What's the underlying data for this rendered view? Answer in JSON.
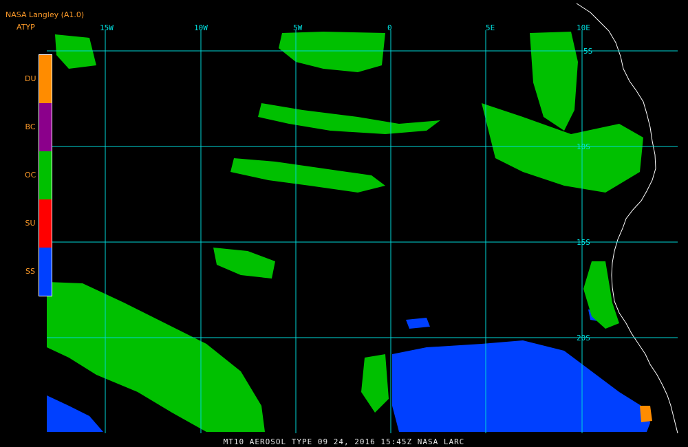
{
  "header": {
    "source": "NASA Langley (A1.0)",
    "product": "ATYP"
  },
  "legend": {
    "items": [
      {
        "code": "DU",
        "color": "#ff8c00"
      },
      {
        "code": "BC",
        "color": "#8b008b"
      },
      {
        "code": "OC",
        "color": "#00c000"
      },
      {
        "code": "SU",
        "color": "#ff0000"
      },
      {
        "code": "SS",
        "color": "#0040ff"
      }
    ]
  },
  "grid": {
    "longitudes": [
      "15W",
      "10W",
      "5W",
      "0",
      "5E",
      "10E"
    ],
    "latitudes": [
      "5S",
      "10S",
      "15S",
      "20S"
    ]
  },
  "footer": {
    "text": "MT10  AEROSOL TYPE   09 24, 2016 15:45Z   NASA LARC"
  }
}
